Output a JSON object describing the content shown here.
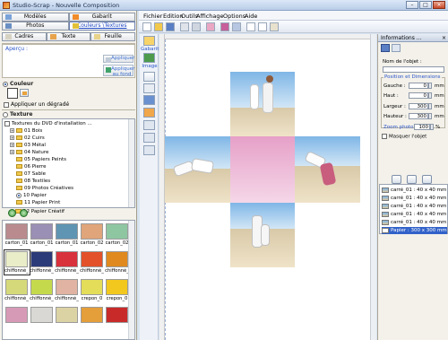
{
  "window": {
    "title": "Studio-Scrap - Nouvelle Composition"
  },
  "tabs_top": [
    {
      "label": "Modèles"
    },
    {
      "label": "Gabarit"
    }
  ],
  "tabs_mid": [
    {
      "label": "Photos"
    },
    {
      "label": "Couleurs \\Textures"
    }
  ],
  "tabs_bottom": [
    {
      "label": "Cadres"
    },
    {
      "label": "Texte"
    },
    {
      "label": "Feuille"
    }
  ],
  "preview": {
    "label": "Aperçu :",
    "apply_label": "Appliquer",
    "apply_bg_label": "Appliquer au fond"
  },
  "color_section": {
    "label": "Couleur",
    "gradient_label": "Appliquer un dégradé",
    "swatch": "#ffffff"
  },
  "texture_section": {
    "label": "Texture"
  },
  "tree": {
    "items": [
      {
        "label": "Textures du DVD d'installation ..."
      },
      {
        "label": "01 Bois"
      },
      {
        "label": "02 Cuirs"
      },
      {
        "label": "03 Métal"
      },
      {
        "label": "04 Nature"
      },
      {
        "label": "05 Papiers Peints"
      },
      {
        "label": "06 Pierre"
      },
      {
        "label": "07 Sable"
      },
      {
        "label": "08 Textiles"
      },
      {
        "label": "09 Photos Créatives"
      },
      {
        "label": "10 Papier"
      },
      {
        "label": "11 Papier Print"
      },
      {
        "label": "12 Papier Créatif"
      }
    ]
  },
  "textures": [
    {
      "label": "carton_01",
      "color": "#b98b8e"
    },
    {
      "label": "carton_01",
      "color": "#9a8fb4"
    },
    {
      "label": "carton_01",
      "color": "#5f94b3"
    },
    {
      "label": "carton_02",
      "color": "#e0a57a"
    },
    {
      "label": "carton_02",
      "color": "#8fc6a2"
    },
    {
      "label": "chiffonné_",
      "color": "#e9edc8"
    },
    {
      "label": "chiffonné_",
      "color": "#2b3a78"
    },
    {
      "label": "chiffonné_",
      "color": "#d8323c"
    },
    {
      "label": "chiffonné_",
      "color": "#e2512a"
    },
    {
      "label": "chiffonné_",
      "color": "#e0891e"
    },
    {
      "label": "chiffonné_",
      "color": "#d6d97a"
    },
    {
      "label": "chiffonné_",
      "color": "#c5d94d"
    },
    {
      "label": "chiffonné_",
      "color": "#e0b3a3"
    },
    {
      "label": "crepon_0",
      "color": "#e3dd5a"
    },
    {
      "label": "crepon_0",
      "color": "#f2c81e"
    },
    {
      "label": "",
      "color": "#d79ab6"
    },
    {
      "label": "",
      "color": "#d9d8d4"
    },
    {
      "label": "",
      "color": "#dcd3a4"
    },
    {
      "label": "",
      "color": "#e49e3a"
    },
    {
      "label": "",
      "color": "#c82a2a"
    }
  ],
  "menu": [
    {
      "label": "Fichier"
    },
    {
      "label": "Edition"
    },
    {
      "label": "Outils"
    },
    {
      "label": "Affichage"
    },
    {
      "label": "Options"
    },
    {
      "label": "Aide"
    }
  ],
  "lefttools": {
    "gabarit_label": "Gabarit",
    "image_label": "Image"
  },
  "canvas": {
    "center_color": "#e493c3"
  },
  "info_panel": {
    "title": "Informations ...",
    "object_name_label": "Nom de l'objet :",
    "position_title": "Position et Dimensions",
    "left_label": "Gauche :",
    "left_value": "0",
    "left_unit": "mm",
    "top_label": "Haut :",
    "top_value": "0",
    "top_unit": "mm",
    "width_label": "Largeur :",
    "width_value": "300",
    "width_unit": "mm",
    "height_label": "Hauteur :",
    "height_value": "300",
    "height_unit": "mm",
    "zoom_label": "Zoom photo",
    "zoom_value": "100",
    "zoom_unit": "%",
    "hide_label": "Masquer l'objet",
    "objects": [
      {
        "label": "carré_01 : 40 x 40 mm"
      },
      {
        "label": "carré_01 : 40 x 40 mm"
      },
      {
        "label": "carré_01 : 40 x 40 mm"
      },
      {
        "label": "carré_01 : 40 x 40 mm"
      },
      {
        "label": "carré_01 : 40 x 40 mm"
      },
      {
        "label": "Papier : 300 x 300 mm"
      }
    ]
  }
}
